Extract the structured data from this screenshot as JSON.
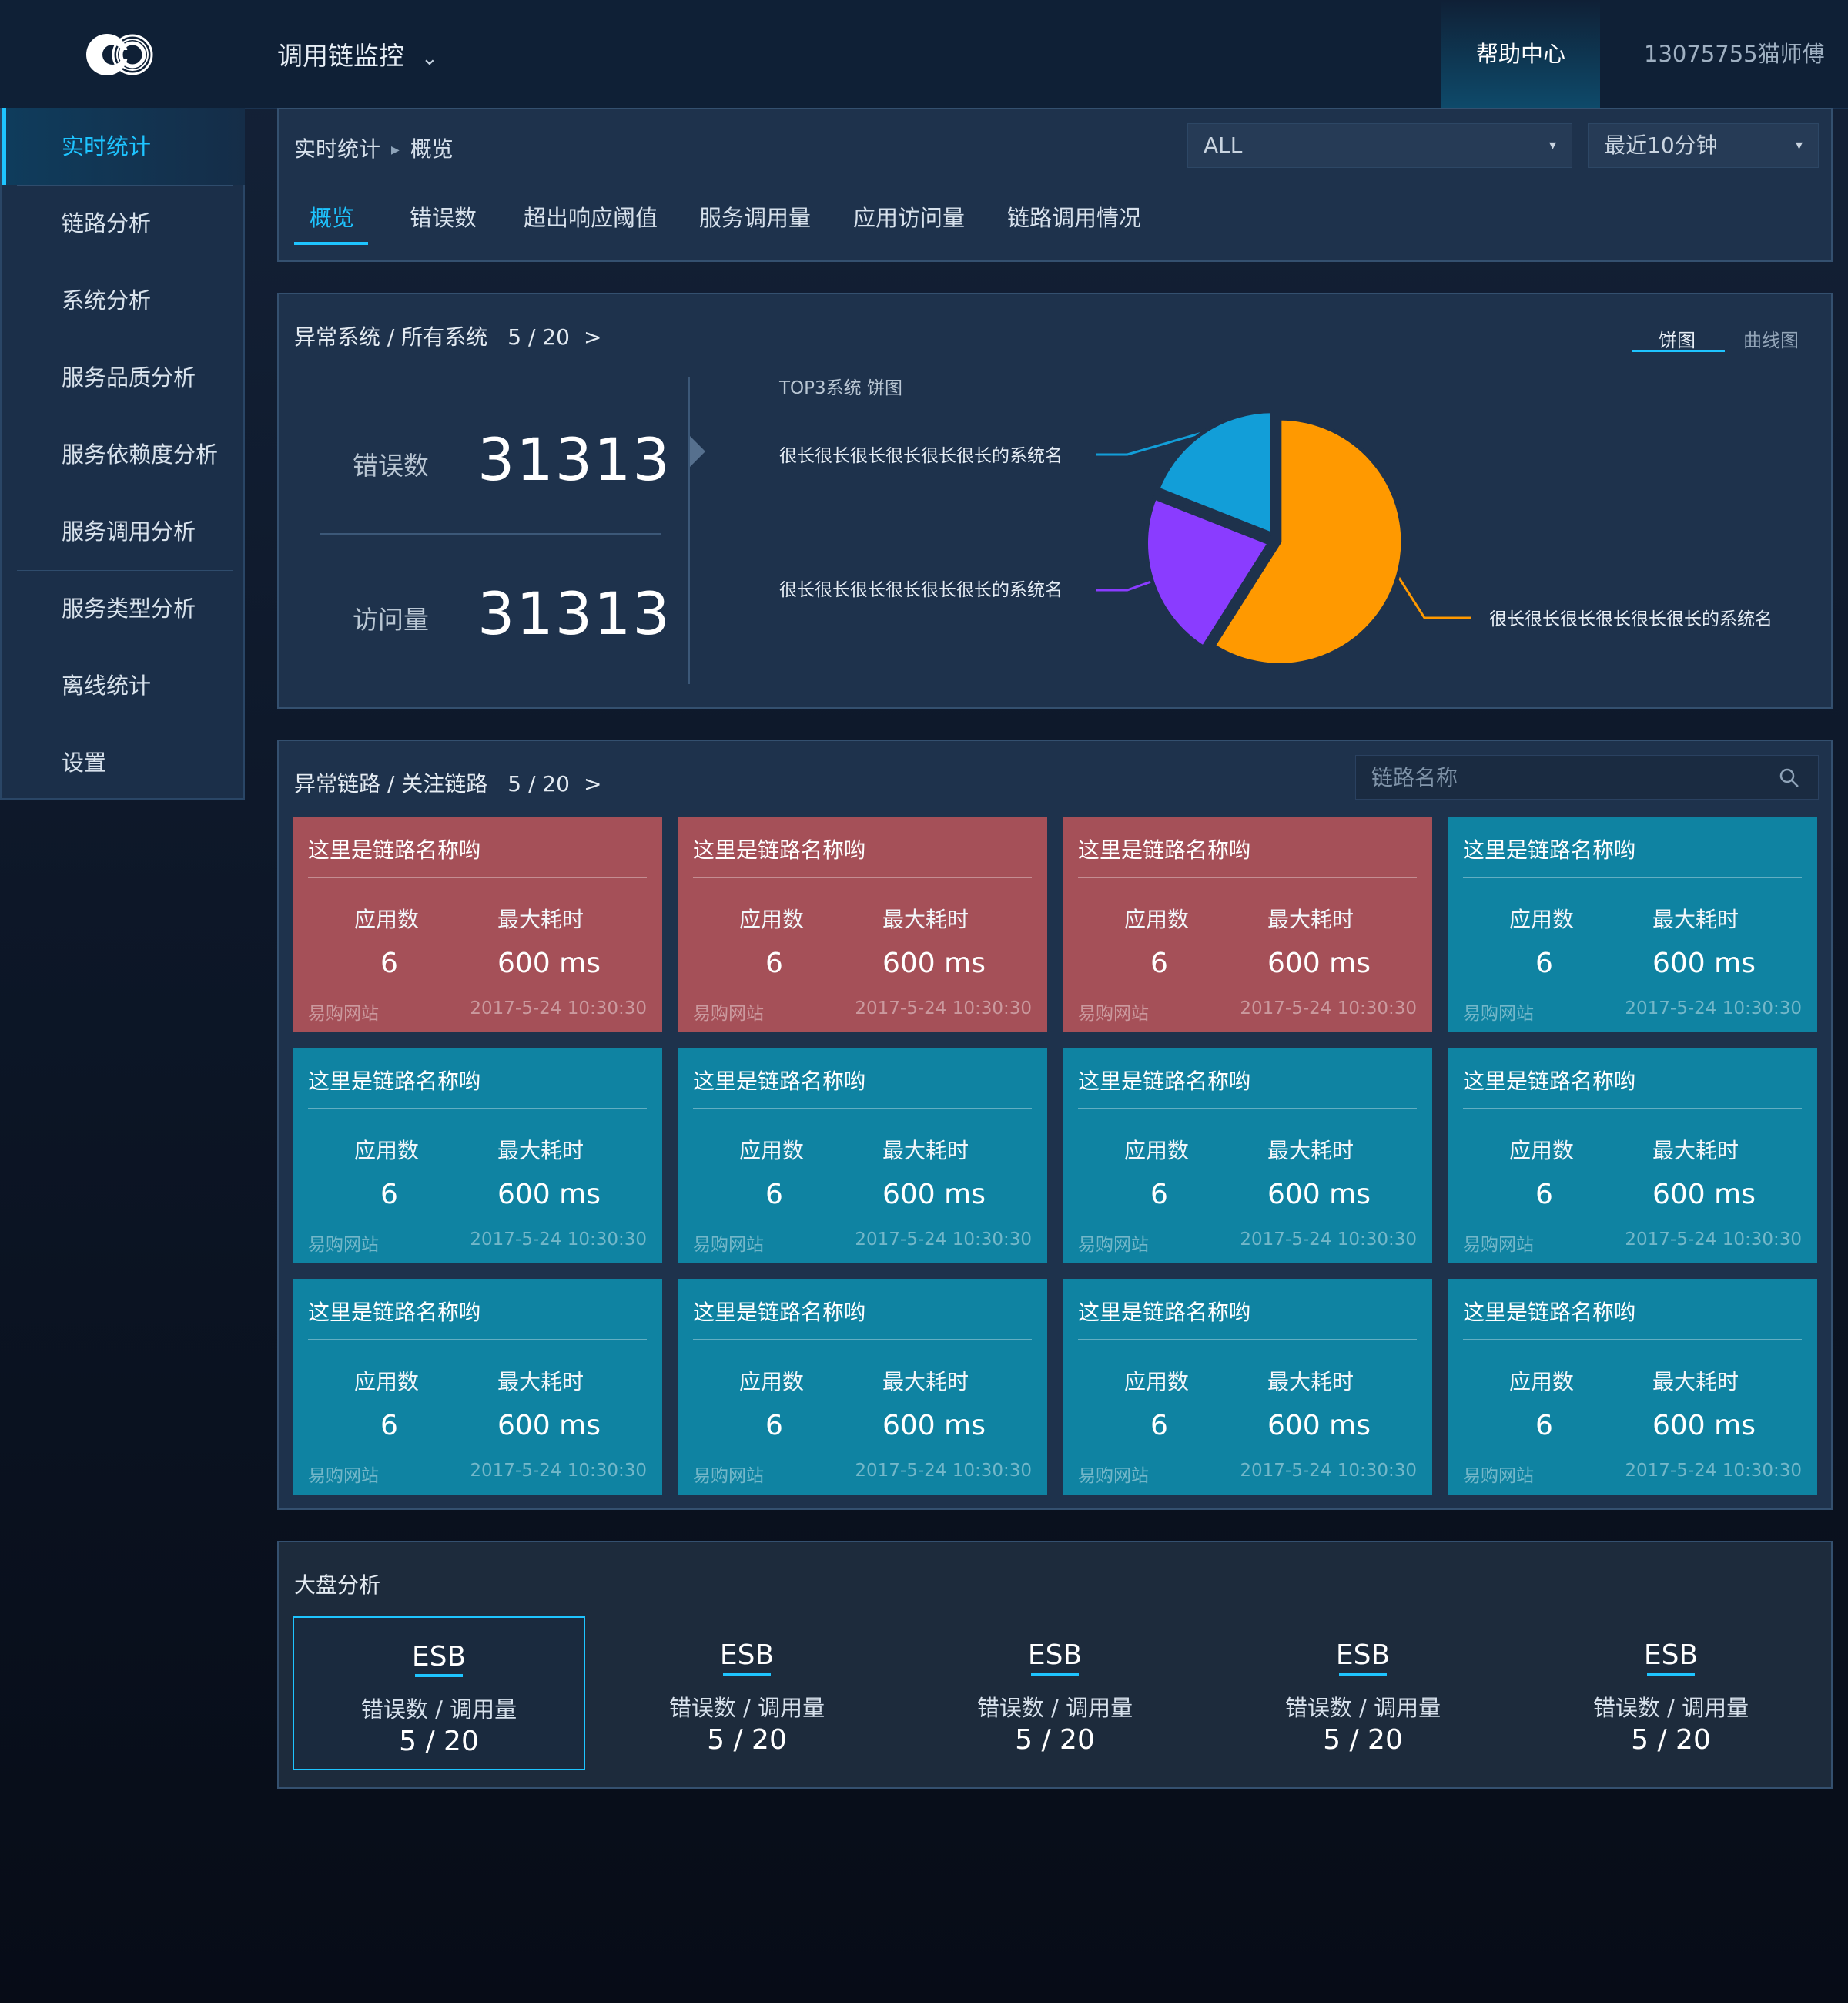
{
  "header": {
    "app_title": "调用链监控",
    "help_label": "帮助中心",
    "user_name": "13075755猫师傅"
  },
  "sidebar": {
    "items": [
      {
        "label": "实时统计",
        "active": true
      },
      {
        "label": "链路分析"
      },
      {
        "label": "系统分析"
      },
      {
        "label": "服务品质分析"
      },
      {
        "label": "服务依赖度分析"
      },
      {
        "label": "服务调用分析"
      },
      {
        "label": "服务类型分析"
      },
      {
        "label": "离线统计"
      },
      {
        "label": "设置"
      }
    ]
  },
  "overview": {
    "breadcrumb": [
      "实时统计",
      "概览"
    ],
    "filter_scope": "ALL",
    "filter_time": "最近10分钟",
    "tabs": [
      "概览",
      "错误数",
      "超出响应阈值",
      "服务调用量",
      "应用访问量",
      "链路调用情况"
    ],
    "active_tab": "概览"
  },
  "systems": {
    "title": "异常系统 / 所有系统",
    "count": "5 / 20",
    "more": ">",
    "error_label": "错误数",
    "error_value": "31313",
    "visit_label": "访问量",
    "visit_value": "31313",
    "toggle_pie": "饼图",
    "toggle_curve": "曲线图",
    "chart_caption": "TOP3系统 饼图"
  },
  "chart_data": {
    "type": "pie",
    "title": "TOP3系统 饼图",
    "slices": [
      {
        "label": "很长很长很长很长很长很长的系统名",
        "value": 59,
        "color": "#ff9900"
      },
      {
        "label": "很长很长很长很长很长很长的系统名",
        "value": 22,
        "color": "#8a3cff"
      },
      {
        "label": "很长很长很长很长很长很长的系统名",
        "value": 19,
        "color": "#129ed8"
      }
    ]
  },
  "links": {
    "title": "异常链路 / 关注链路",
    "count": "5 / 20",
    "more": ">",
    "search_placeholder": "链路名称",
    "cards": [
      {
        "status": "error",
        "name": "这里是链路名称哟",
        "app_label": "应用数",
        "app_count": "6",
        "time_label": "最大耗时",
        "max_time": "600 ms",
        "site": "易购网站",
        "date": "2017-5-24 10:30:30"
      },
      {
        "status": "error",
        "name": "这里是链路名称哟",
        "app_label": "应用数",
        "app_count": "6",
        "time_label": "最大耗时",
        "max_time": "600 ms",
        "site": "易购网站",
        "date": "2017-5-24 10:30:30"
      },
      {
        "status": "error",
        "name": "这里是链路名称哟",
        "app_label": "应用数",
        "app_count": "6",
        "time_label": "最大耗时",
        "max_time": "600 ms",
        "site": "易购网站",
        "date": "2017-5-24 10:30:30"
      },
      {
        "status": "normal",
        "name": "这里是链路名称哟",
        "app_label": "应用数",
        "app_count": "6",
        "time_label": "最大耗时",
        "max_time": "600 ms",
        "site": "易购网站",
        "date": "2017-5-24 10:30:30"
      },
      {
        "status": "normal",
        "name": "这里是链路名称哟",
        "app_label": "应用数",
        "app_count": "6",
        "time_label": "最大耗时",
        "max_time": "600 ms",
        "site": "易购网站",
        "date": "2017-5-24 10:30:30"
      },
      {
        "status": "normal",
        "name": "这里是链路名称哟",
        "app_label": "应用数",
        "app_count": "6",
        "time_label": "最大耗时",
        "max_time": "600 ms",
        "site": "易购网站",
        "date": "2017-5-24 10:30:30"
      },
      {
        "status": "normal",
        "name": "这里是链路名称哟",
        "app_label": "应用数",
        "app_count": "6",
        "time_label": "最大耗时",
        "max_time": "600 ms",
        "site": "易购网站",
        "date": "2017-5-24 10:30:30"
      },
      {
        "status": "normal",
        "name": "这里是链路名称哟",
        "app_label": "应用数",
        "app_count": "6",
        "time_label": "最大耗时",
        "max_time": "600 ms",
        "site": "易购网站",
        "date": "2017-5-24 10:30:30"
      },
      {
        "status": "normal",
        "name": "这里是链路名称哟",
        "app_label": "应用数",
        "app_count": "6",
        "time_label": "最大耗时",
        "max_time": "600 ms",
        "site": "易购网站",
        "date": "2017-5-24 10:30:30"
      },
      {
        "status": "normal",
        "name": "这里是链路名称哟",
        "app_label": "应用数",
        "app_count": "6",
        "time_label": "最大耗时",
        "max_time": "600 ms",
        "site": "易购网站",
        "date": "2017-5-24 10:30:30"
      },
      {
        "status": "normal",
        "name": "这里是链路名称哟",
        "app_label": "应用数",
        "app_count": "6",
        "time_label": "最大耗时",
        "max_time": "600 ms",
        "site": "易购网站",
        "date": "2017-5-24 10:30:30"
      },
      {
        "status": "normal",
        "name": "这里是链路名称哟",
        "app_label": "应用数",
        "app_count": "6",
        "time_label": "最大耗时",
        "max_time": "600 ms",
        "site": "易购网站",
        "date": "2017-5-24 10:30:30"
      }
    ]
  },
  "market": {
    "title": "大盘分析",
    "items": [
      {
        "name": "ESB",
        "label": "错误数 / 调用量",
        "value": "5 / 20",
        "selected": true
      },
      {
        "name": "ESB",
        "label": "错误数 / 调用量",
        "value": "5 / 20"
      },
      {
        "name": "ESB",
        "label": "错误数 / 调用量",
        "value": "5 / 20"
      },
      {
        "name": "ESB",
        "label": "错误数 / 调用量",
        "value": "5 / 20"
      },
      {
        "name": "ESB",
        "label": "错误数 / 调用量",
        "value": "5 / 20"
      }
    ]
  },
  "colors": {
    "accent": "#1ec4ff",
    "error_card": "#a55058",
    "normal_card": "#0f83a2",
    "panel": "#1e324c"
  },
  "icons": {
    "logo": "co-logo-icon",
    "dropdown": "chevron-down-icon",
    "select_caret": "caret-down-icon",
    "search": "search-icon",
    "breadcrumb_separator": "triangle-right-icon"
  }
}
